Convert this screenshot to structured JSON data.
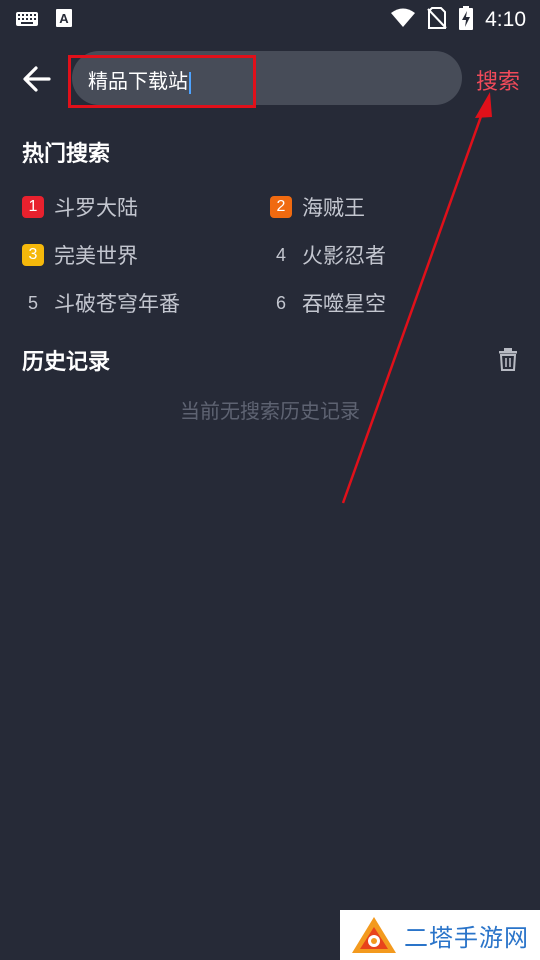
{
  "status_bar": {
    "time": "4:10",
    "icons": [
      "keyboard-icon",
      "text-a-icon",
      "wifi-icon",
      "no-sim-icon",
      "battery-charging-icon"
    ]
  },
  "search": {
    "value": "精品下载站",
    "button_label": "搜索"
  },
  "hot": {
    "title": "热门搜索",
    "items": [
      {
        "rank": "1",
        "label": "斗罗大陆",
        "badge_color": "#e8212e"
      },
      {
        "rank": "2",
        "label": "海贼王",
        "badge_color": "#f06a10"
      },
      {
        "rank": "3",
        "label": "完美世界",
        "badge_color": "#f5b80b"
      },
      {
        "rank": "4",
        "label": "火影忍者",
        "badge_color": null
      },
      {
        "rank": "5",
        "label": "斗破苍穹年番",
        "badge_color": null
      },
      {
        "rank": "6",
        "label": "吞噬星空",
        "badge_color": null
      }
    ]
  },
  "history": {
    "title": "历史记录",
    "empty_text": "当前无搜索历史记录"
  },
  "watermark": {
    "text": "二塔手游网"
  },
  "colors": {
    "background": "#262a37",
    "accent": "#f04a5a",
    "annotation": "#e0101a"
  }
}
